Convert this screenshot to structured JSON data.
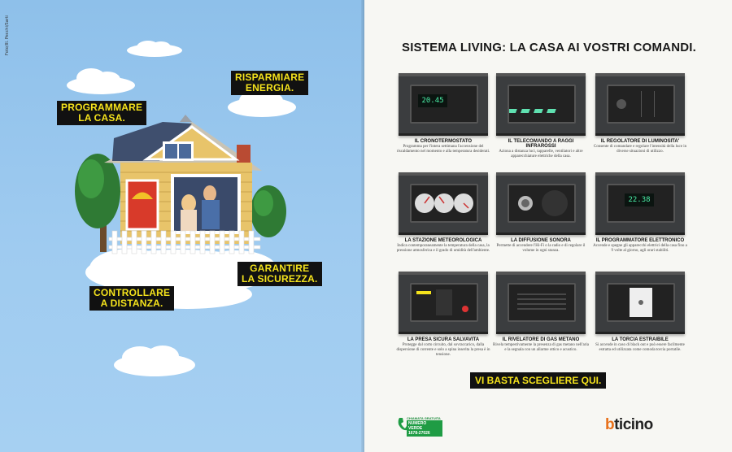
{
  "left": {
    "credit": "Foto/Ill. Pecchi/Sarti",
    "labels": {
      "programmare": "PROGRAMMARE\nLA CASA.",
      "risparmiare": "RISPARMIARE\nENERGIA.",
      "garantire": "GARANTIRE\nLA SICUREZZA.",
      "controllare": "CONTROLLARE\nA DISTANZA."
    }
  },
  "right": {
    "headline": "SISTEMA LIVING: LA CASA AI VOSTRI COMANDI.",
    "products": [
      {
        "name": "IL CRONOTERMOSTATO",
        "desc": "Programma per l'intera settimana l'accensione del riscaldamento nel momento e alla temperatura desiderati.",
        "display": "20.45"
      },
      {
        "name": "IL TELECOMANDO A RAGGI INFRAROSSI",
        "desc": "Aziona a distanza luci, tapparelle, ventilatori e altre apparecchiature elettriche della casa.",
        "display": ""
      },
      {
        "name": "IL REGOLATORE DI LUMINOSITA'",
        "desc": "Consente di comandare e regolare l'intensità della luce in diverse situazioni di utilizzo.",
        "display": ""
      },
      {
        "name": "LA STAZIONE METEOROLOGICA",
        "desc": "Indica contemporaneamente la temperatura della casa, la pressione atmosferica e il grado di umidità dell'ambiente.",
        "display": ""
      },
      {
        "name": "LA DIFFUSIONE SONORA",
        "desc": "Permette di accendere l'Hi-Fi o la radio e di regolare il volume in ogni stanza.",
        "display": ""
      },
      {
        "name": "IL PROGRAMMATORE ELETTRONICO",
        "desc": "Accende e spegne gli apparecchi elettrici della casa fino a 9 volte al giorno, agli orari stabiliti.",
        "display": "22.38"
      },
      {
        "name": "LA PRESA SICURA SALVAVITA",
        "desc": "Protegge dal corto circuito, dal sovraccarico, dalla dispersione di corrente e solo a spina inserita la presa è in tensione.",
        "display": ""
      },
      {
        "name": "IL RIVELATORE DI GAS METANO",
        "desc": "Rivela tempestivamente la presenza di gas metano nell'aria e la segnala con un allarme ottico e acustico.",
        "display": ""
      },
      {
        "name": "LA TORCIA ESTRAIBILE",
        "desc": "Si accende in caso di black out e può essere facilmente estratta ed utilizzata come comoda torcia portatile.",
        "display": ""
      }
    ],
    "cta": "VI BASTA SCEGLIERE QUI.",
    "numero_verde": {
      "top": "CHIAMATA GRATUITA",
      "line1": "NUMERO VERDE",
      "line2": "1678-27026"
    },
    "brand_b": "b",
    "brand_rest": "ticino",
    "colors": {
      "accent_yellow": "#f4e21c",
      "brand_orange": "#e8701a",
      "lcd_green": "#4bf0a8"
    }
  }
}
